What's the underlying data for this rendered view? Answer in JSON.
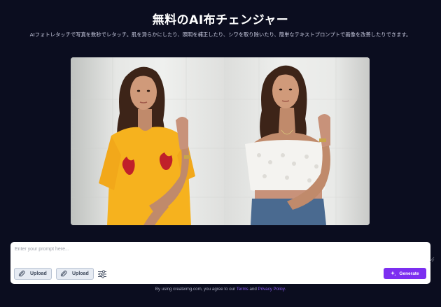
{
  "header": {
    "title": "無料のAI布チェンジャー",
    "subtitle": "AIフォトレタッチで写真を数秒でレタッチ。肌を滑らかにしたり、照明を補正したり、シワを取り除いたり、簡単なテキストプロンプトで画像を改善したりできます。"
  },
  "preview": {
    "before_image": "woman-yellow-tshirt-photo",
    "after_image": "woman-white-lace-top-photo"
  },
  "prompt": {
    "placeholder": "Enter your prompt here...",
    "value": "",
    "upload_1_label": "Upload",
    "upload_2_label": "Upload",
    "generate_label": "Generate"
  },
  "footer": {
    "prefix": "By using createimg.com, you agree to our",
    "terms_label": "Terms",
    "and": "and",
    "privacy_label": "Privacy Policy."
  },
  "colors": {
    "background": "#0b0d1f",
    "accent": "#7c2ff0",
    "link": "#8b5cf6"
  }
}
